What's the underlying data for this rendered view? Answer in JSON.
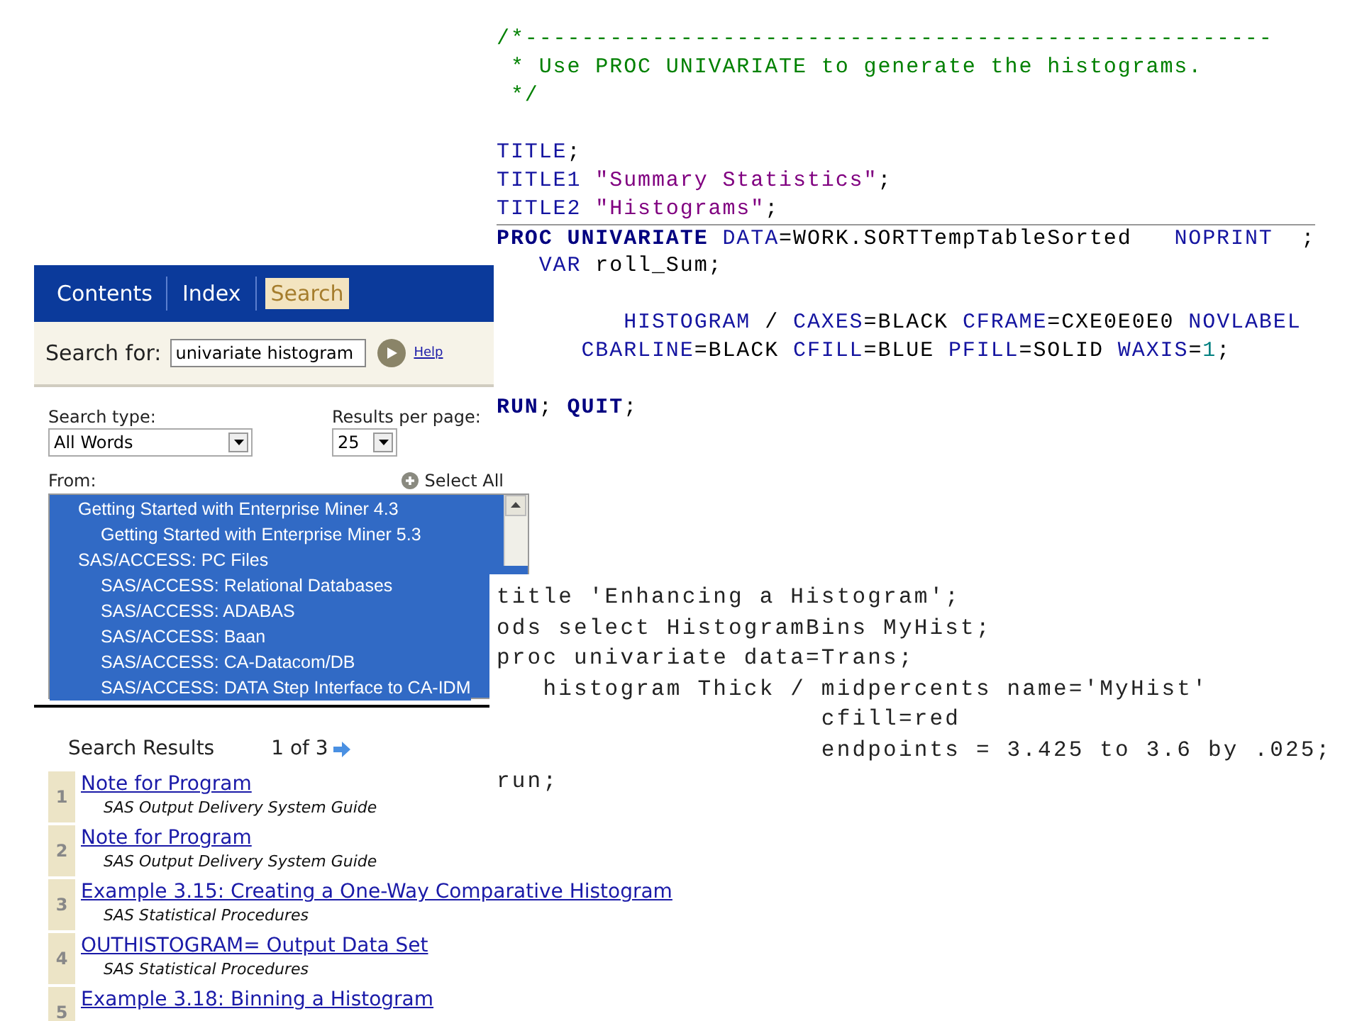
{
  "code_editor": {
    "lines": [
      {
        "tokens": [
          {
            "kind": "comment",
            "text": "/*-----------------------------------------------------"
          }
        ]
      },
      {
        "tokens": [
          {
            "kind": "comment",
            "text": " * Use PROC UNIVARIATE to generate the histograms."
          }
        ]
      },
      {
        "tokens": [
          {
            "kind": "comment",
            "text": " */"
          }
        ]
      },
      {
        "space_before": true,
        "tokens": [
          {
            "kind": "keyword",
            "text": "TITLE"
          },
          {
            "kind": "plain",
            "text": ";"
          }
        ]
      },
      {
        "tokens": [
          {
            "kind": "keyword",
            "text": "TITLE1"
          },
          {
            "kind": "string",
            "text": " \"Summary Statistics\""
          },
          {
            "kind": "plain",
            "text": ";"
          }
        ]
      },
      {
        "tokens": [
          {
            "kind": "keyword",
            "text": "TITLE2"
          },
          {
            "kind": "string",
            "text": " \"Histograms\""
          },
          {
            "kind": "plain",
            "text": ";"
          }
        ]
      },
      {
        "rule_before": true,
        "tokens": [
          {
            "kind": "proc",
            "text": "PROC UNIVARIATE"
          },
          {
            "kind": "keyword",
            "text": " DATA"
          },
          {
            "kind": "plain",
            "text": "=WORK.SORTTempTableSorted   "
          },
          {
            "kind": "keyword",
            "text": "NOPRINT"
          },
          {
            "kind": "plain",
            "text": "  ;"
          }
        ]
      },
      {
        "tokens": [
          {
            "kind": "keyword",
            "text": "   VAR"
          },
          {
            "kind": "plain",
            "text": " roll_Sum;"
          }
        ]
      },
      {
        "space_before": true,
        "tokens": [
          {
            "kind": "keyword",
            "text": "         HISTOGRAM"
          },
          {
            "kind": "plain",
            "text": " / "
          },
          {
            "kind": "keyword",
            "text": "CAXES"
          },
          {
            "kind": "plain",
            "text": "=BLACK "
          },
          {
            "kind": "keyword",
            "text": "CFRAME"
          },
          {
            "kind": "plain",
            "text": "=CXE0E0E0 "
          },
          {
            "kind": "keyword",
            "text": "NOVLABEL"
          }
        ]
      },
      {
        "tokens": [
          {
            "kind": "keyword",
            "text": "      CBARLINE"
          },
          {
            "kind": "plain",
            "text": "=BLACK "
          },
          {
            "kind": "keyword",
            "text": "CFILL"
          },
          {
            "kind": "plain",
            "text": "=BLUE "
          },
          {
            "kind": "keyword",
            "text": "PFILL"
          },
          {
            "kind": "plain",
            "text": "=SOLID "
          },
          {
            "kind": "keyword",
            "text": "WAXIS"
          },
          {
            "kind": "plain",
            "text": "="
          },
          {
            "kind": "number",
            "text": "1"
          },
          {
            "kind": "plain",
            "text": ";"
          }
        ]
      },
      {
        "space_before": true,
        "tokens": [
          {
            "kind": "proc",
            "text": "RUN"
          },
          {
            "kind": "plain",
            "text": "; "
          },
          {
            "kind": "proc",
            "text": "QUIT"
          },
          {
            "kind": "plain",
            "text": ";"
          }
        ]
      }
    ]
  },
  "help_panel": {
    "tabs": [
      {
        "label": "Contents",
        "selected": false
      },
      {
        "label": "Index",
        "selected": false
      },
      {
        "label": "Search",
        "selected": true
      }
    ],
    "search": {
      "label": "Search for:",
      "value": "univariate histogram",
      "help_link": "Help"
    },
    "search_type": {
      "label": "Search type:",
      "value": "All Words"
    },
    "results_per_page": {
      "label": "Results per page:",
      "value": "25"
    },
    "from": {
      "label": "From:",
      "select_all": "Select All",
      "items": [
        {
          "label": "Getting Started with Enterprise Miner 4.3",
          "selected": true,
          "children": [
            {
              "label": "Getting Started with Enterprise Miner 5.3",
              "selected": true
            }
          ]
        },
        {
          "label": "SAS/ACCESS: PC Files",
          "selected": true,
          "children": [
            {
              "label": "SAS/ACCESS: Relational Databases",
              "selected": true
            },
            {
              "label": "SAS/ACCESS: ADABAS",
              "selected": true
            },
            {
              "label": "SAS/ACCESS: Baan",
              "selected": true
            },
            {
              "label": "SAS/ACCESS: CA-Datacom/DB",
              "selected": true
            },
            {
              "label": "SAS/ACCESS: DATA Step Interface to CA-IDM",
              "selected": true
            }
          ]
        }
      ]
    }
  },
  "code_snippet": {
    "lines": [
      "title 'Enhancing a Histogram';",
      "ods select HistogramBins MyHist;",
      "proc univariate data=Trans;",
      "   histogram Thick / midpercents name='MyHist'",
      "                     cfill=red",
      "                     endpoints = 3.425 to 3.6 by .025;",
      "run;"
    ]
  },
  "search_results": {
    "title": "Search Results",
    "page": "1 of 3",
    "items": [
      {
        "number": "1",
        "title": "Note for Program",
        "source": "SAS Output Delivery System Guide"
      },
      {
        "number": "2",
        "title": "Note for Program",
        "source": "SAS Output Delivery System Guide"
      },
      {
        "number": "3",
        "title": "Example 3.15: Creating a One-Way Comparative Histogram",
        "source": "SAS Statistical Procedures"
      },
      {
        "number": "4",
        "title": "OUTHISTOGRAM= Output Data Set",
        "source": "SAS Statistical Procedures"
      },
      {
        "number": "5",
        "title": "Example 3.18: Binning a Histogram"
      }
    ]
  }
}
